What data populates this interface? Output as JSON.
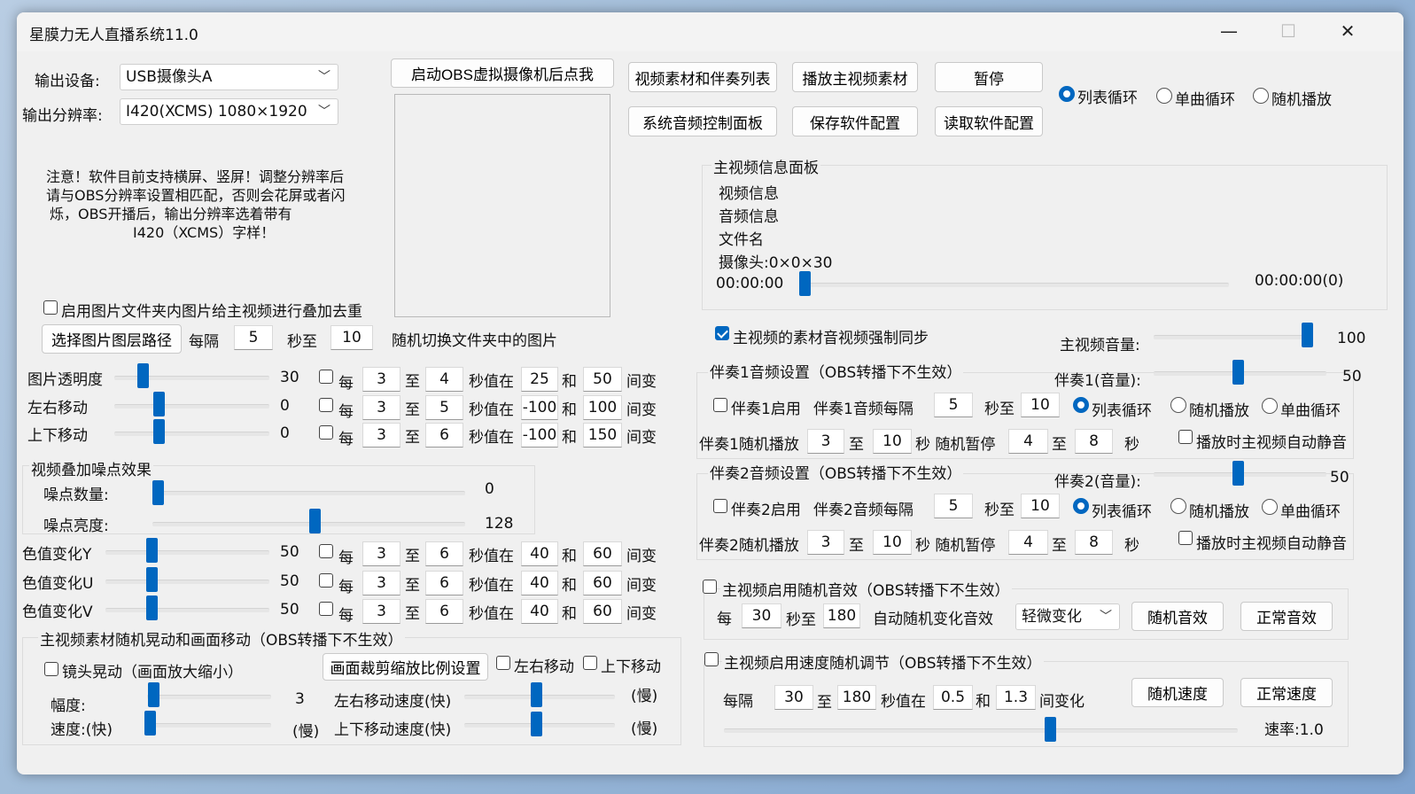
{
  "window": {
    "title": "星膜力无人直播系统11.0",
    "minimize": "—",
    "maximize": "☐",
    "close": "✕"
  },
  "output": {
    "device_label": "输出设备:",
    "device_value": "USB摄像头A",
    "resolution_label": "输出分辨率:",
    "resolution_value": "I420(XCMS) 1080×1920"
  },
  "notice": {
    "line1": "注意！软件目前支持横屏、竖屏！调整分辨率后",
    "line2": "请与OBS分辨率设置相匹配，否则会花屏或者闪",
    "line3": "烁，OBS开播后，输出分辨率选着带有",
    "line4": "I420（XCMS）字样！"
  },
  "top_buttons": {
    "start_obs": "启动OBS虚拟摄像机后点我",
    "video_list": "视频素材和伴奏列表",
    "play_main": "播放主视频素材",
    "pause": "暂停",
    "audio_panel": "系统音频控制面板",
    "save_config": "保存软件配置",
    "load_config": "读取软件配置"
  },
  "loop_mode": {
    "list": "列表循环",
    "single": "单曲循环",
    "random": "随机播放",
    "selected": "list"
  },
  "main_info": {
    "panel_title": "主视频信息面板",
    "video_info": "视频信息",
    "audio_info": "音频信息",
    "file_name": "文件名",
    "camera": "摄像头:0×0×30",
    "time_start": "00:00:00",
    "time_end": "00:00:00(0)",
    "progress": 0
  },
  "image_overlay": {
    "enable_label": "启用图片文件夹内图片给主视频进行叠加去重",
    "enabled": false,
    "choose_path": "选择图片图层路径",
    "every": "每隔",
    "from": "5",
    "to_label": "秒至",
    "to": "10",
    "switch_text": "随机切换文件夹中的图片"
  },
  "common": {
    "each": "每",
    "to": "至",
    "sec_value_at": "秒值在",
    "and": "和",
    "change": "间变"
  },
  "image_rows": [
    {
      "label": "图片透明度",
      "value": "30",
      "level": 0.3,
      "checked": false,
      "a": "3",
      "b": "4",
      "lo": "25",
      "hi": "50"
    },
    {
      "label": "左右移动",
      "value": "0",
      "level": 0.5,
      "checked": false,
      "a": "3",
      "b": "5",
      "lo": "-100",
      "hi": "100"
    },
    {
      "label": "上下移动",
      "value": "0",
      "level": 0.5,
      "checked": false,
      "a": "3",
      "b": "6",
      "lo": "-100",
      "hi": "150"
    }
  ],
  "noise": {
    "title": "视频叠加噪点效果",
    "count_label": "噪点数量:",
    "count_value": "0",
    "count_level": 0,
    "bright_label": "噪点亮度:",
    "bright_value": "128",
    "bright_level": 0.5
  },
  "color_rows": [
    {
      "label": "色值变化Y",
      "value": "50",
      "level": 0.5,
      "checked": false,
      "a": "3",
      "b": "6",
      "lo": "40",
      "hi": "60"
    },
    {
      "label": "色值变化U",
      "value": "50",
      "level": 0.5,
      "checked": false,
      "a": "3",
      "b": "6",
      "lo": "40",
      "hi": "60"
    },
    {
      "label": "色值变化V",
      "value": "50",
      "level": 0.5,
      "checked": false,
      "a": "3",
      "b": "6",
      "lo": "40",
      "hi": "60"
    }
  ],
  "motion": {
    "title": "主视频素材随机晃动和画面移动（OBS转播下不生效）",
    "lens_shake": "镜头晃动（画面放大缩小）",
    "crop_button": "画面裁剪缩放比例设置",
    "lr_move": "左右移动",
    "ud_move": "上下移动",
    "amplitude_label": "幅度:",
    "amplitude_value": "3",
    "speed_label": "速度:(快)",
    "slow": "(慢)",
    "lr_speed": "左右移动速度(快)",
    "ud_speed": "上下移动速度(快)"
  },
  "sync": {
    "label": "主视频的素材音视频强制同步",
    "checked": true,
    "volume_label": "主视频音量:",
    "volume_value": "100",
    "volume_level": 1.0
  },
  "acc1": {
    "title": "伴奏1音频设置（OBS转播下不生效）",
    "volume_label": "伴奏1(音量):",
    "volume_value": "50",
    "volume_level": 0.5,
    "enable": "伴奏1启用",
    "every": "伴奏1音频每隔",
    "a": "5",
    "sec_to": "秒至",
    "b": "10",
    "list": "列表循环",
    "random": "随机播放",
    "single": "单曲循环",
    "rand_play": "伴奏1随机播放",
    "r1": "3",
    "r2": "10",
    "sec_rand_pause": "秒 随机暂停",
    "p1": "4",
    "p2": "8",
    "sec": "秒",
    "auto_mute": "播放时主视频自动静音"
  },
  "acc2": {
    "title": "伴奏2音频设置（OBS转播下不生效）",
    "volume_label": "伴奏2(音量):",
    "volume_value": "50",
    "volume_level": 0.5,
    "enable": "伴奏2启用",
    "every": "伴奏2音频每隔",
    "a": "5",
    "sec_to": "秒至",
    "b": "10",
    "list": "列表循环",
    "random": "随机播放",
    "single": "单曲循环",
    "rand_play": "伴奏2随机播放",
    "r1": "3",
    "r2": "10",
    "sec_rand_pause": "秒 随机暂停",
    "p1": "4",
    "p2": "8",
    "sec": "秒",
    "auto_mute": "播放时主视频自动静音"
  },
  "random_fx": {
    "enable": "主视频启用随机音效（OBS转播下不生效）",
    "each": "每",
    "a": "30",
    "sec_to": "秒至",
    "b": "180",
    "auto": "自动随机变化音效",
    "mode": "轻微变化",
    "random_btn": "随机音效",
    "normal_btn": "正常音效"
  },
  "speed_adj": {
    "enable": "主视频启用速度随机调节（OBS转播下不生效）",
    "every": "每隔",
    "a": "30",
    "to": "至",
    "b": "180",
    "sec_value_at": "秒值在",
    "lo": "0.5",
    "and": "和",
    "hi": "1.3",
    "change": "间变化",
    "random_btn": "随机速度",
    "normal_btn": "正常速度",
    "rate": "速率:1.0",
    "rate_level": 0.5
  }
}
